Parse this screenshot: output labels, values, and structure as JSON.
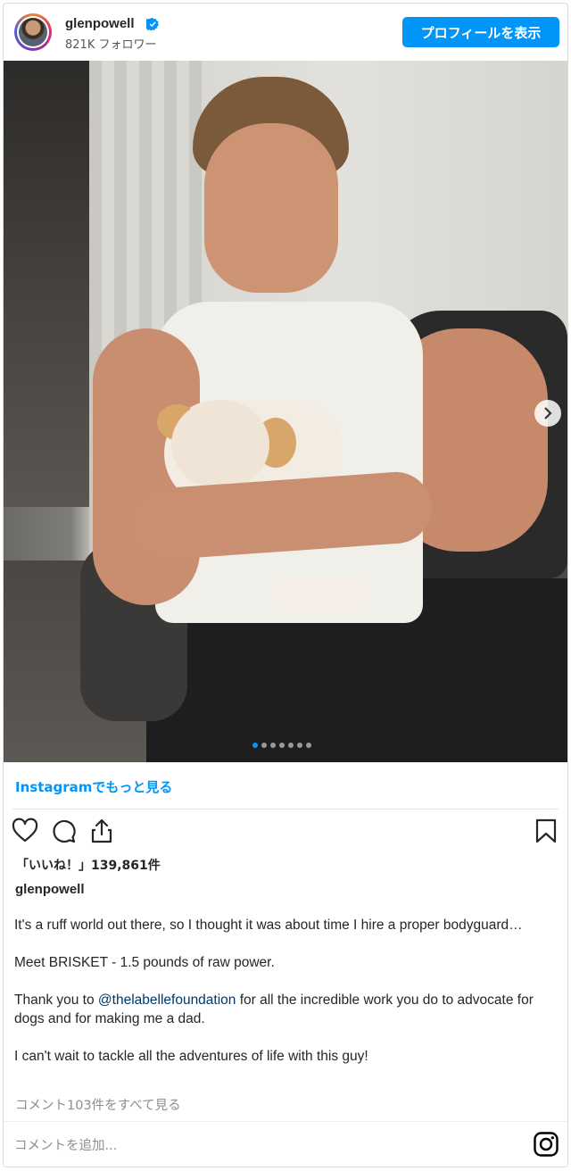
{
  "header": {
    "username": "glenpowell",
    "verified": true,
    "followers": "821K フォロワー",
    "profile_button": "プロフィールを表示"
  },
  "carousel": {
    "image_count": 7,
    "active_index": 0
  },
  "more_link": "Instagramでもっと見る",
  "actions": {
    "icons": [
      "heart-icon",
      "comment-icon",
      "share-icon",
      "bookmark-icon"
    ]
  },
  "likes_text": "「いいね！」139,861件",
  "caption": {
    "username": "glenpowell",
    "p1": "It's a ruff world out there, so I thought it was about time I hire a proper bodyguard…",
    "p2": "Meet BRISKET - 1.5 pounds of raw power.",
    "p3_prefix": "Thank you to ",
    "p3_mention": "@thelabellefoundation",
    "p3_suffix": " for all the incredible work you do to advocate for dogs and for making me a dad.",
    "p4": "I can't wait to tackle all the adventures of life with this guy!"
  },
  "view_comments": "コメント103件をすべて見る",
  "comment_input": {
    "placeholder": "コメントを追加..."
  },
  "colors": {
    "accent": "#0095f6",
    "mention": "#00376b",
    "muted": "#8e8e8e"
  }
}
